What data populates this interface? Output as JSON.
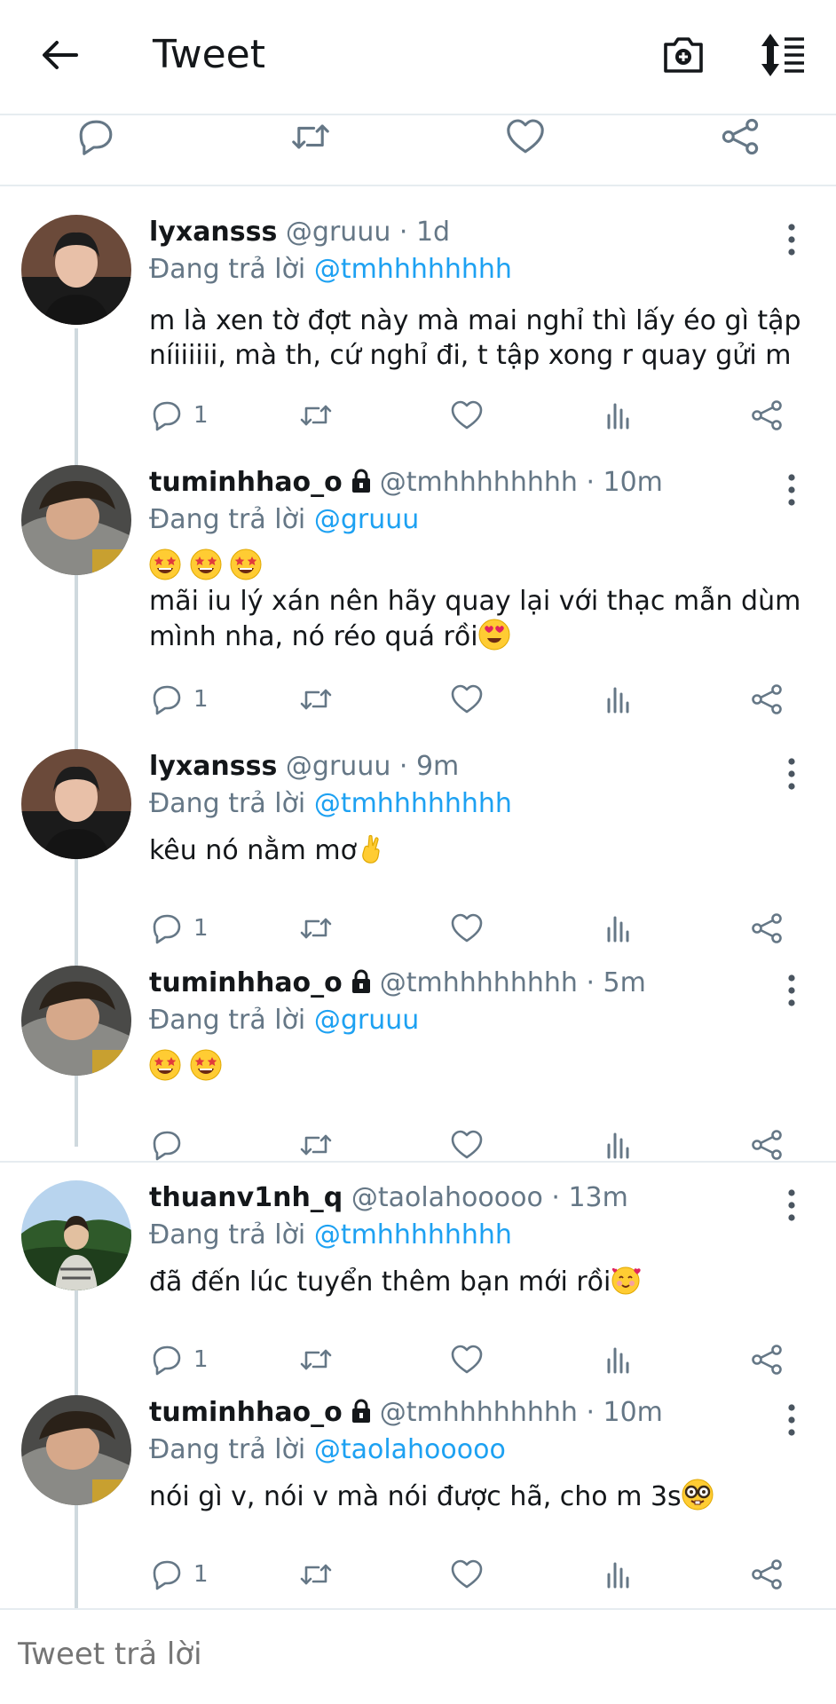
{
  "header": {
    "title": "Tweet"
  },
  "tweets": [
    {
      "name": "lyxansss",
      "handle": "@gruuu",
      "time": "· 1d",
      "locked": false,
      "replying_prefix": "Đang trả lời ",
      "replying_to": "@tmhhhhhhhh",
      "line1": "m là xen tờ đợt này mà mai nghỉ thì lấy éo gì tập",
      "line2": "níiiiiii, mà th, cứ nghỉ đi, t tập xong r quay gửi m",
      "reply_count": "1"
    },
    {
      "name": "tuminhhao_o",
      "handle": "@tmhhhhhhhh",
      "time": "· 10m",
      "locked": true,
      "replying_prefix": "Đang trả lời ",
      "replying_to": "@gruuu",
      "line1": "mãi iu lý xán nên hãy quay lại với thạc mẫn dùm",
      "line2": "mình nha, nó réo quá rồi",
      "reply_count": "1"
    },
    {
      "name": "lyxansss",
      "handle": "@gruuu",
      "time": "· 9m",
      "locked": false,
      "replying_prefix": "Đang trả lời ",
      "replying_to": "@tmhhhhhhhh",
      "line1": "kêu nó nằm mơ",
      "reply_count": "1"
    },
    {
      "name": "tuminhhao_o",
      "handle": "@tmhhhhhhhh",
      "time": "· 5m",
      "locked": true,
      "replying_prefix": "Đang trả lời ",
      "replying_to": "@gruuu",
      "reply_count": ""
    },
    {
      "name": "thuanv1nh_q",
      "handle": "@taolahooooo",
      "time": "· 13m",
      "locked": false,
      "replying_prefix": "Đang trả lời ",
      "replying_to": "@tmhhhhhhhh",
      "line1": "đã đến lúc tuyển thêm bạn mới rồi",
      "reply_count": "1"
    },
    {
      "name": "tuminhhao_o",
      "handle": "@tmhhhhhhhh",
      "time": "· 10m",
      "locked": true,
      "replying_prefix": "Đang trả lời ",
      "replying_to": "@taolahooooo",
      "line1": "nói gì v, nói v mà nói được hã, cho m 3s",
      "reply_count": "1"
    }
  ],
  "composer": {
    "placeholder": "Tweet trả lời"
  },
  "colors": {
    "accent": "#1da1f2",
    "muted": "#657786",
    "text": "#14171a",
    "divider": "#e6ecf0"
  },
  "icons": [
    "back-arrow-icon",
    "camera-add-icon",
    "sort-icon",
    "reply-icon",
    "retweet-icon",
    "like-icon",
    "analytics-icon",
    "share-icon",
    "more-icon",
    "lock-icon"
  ]
}
